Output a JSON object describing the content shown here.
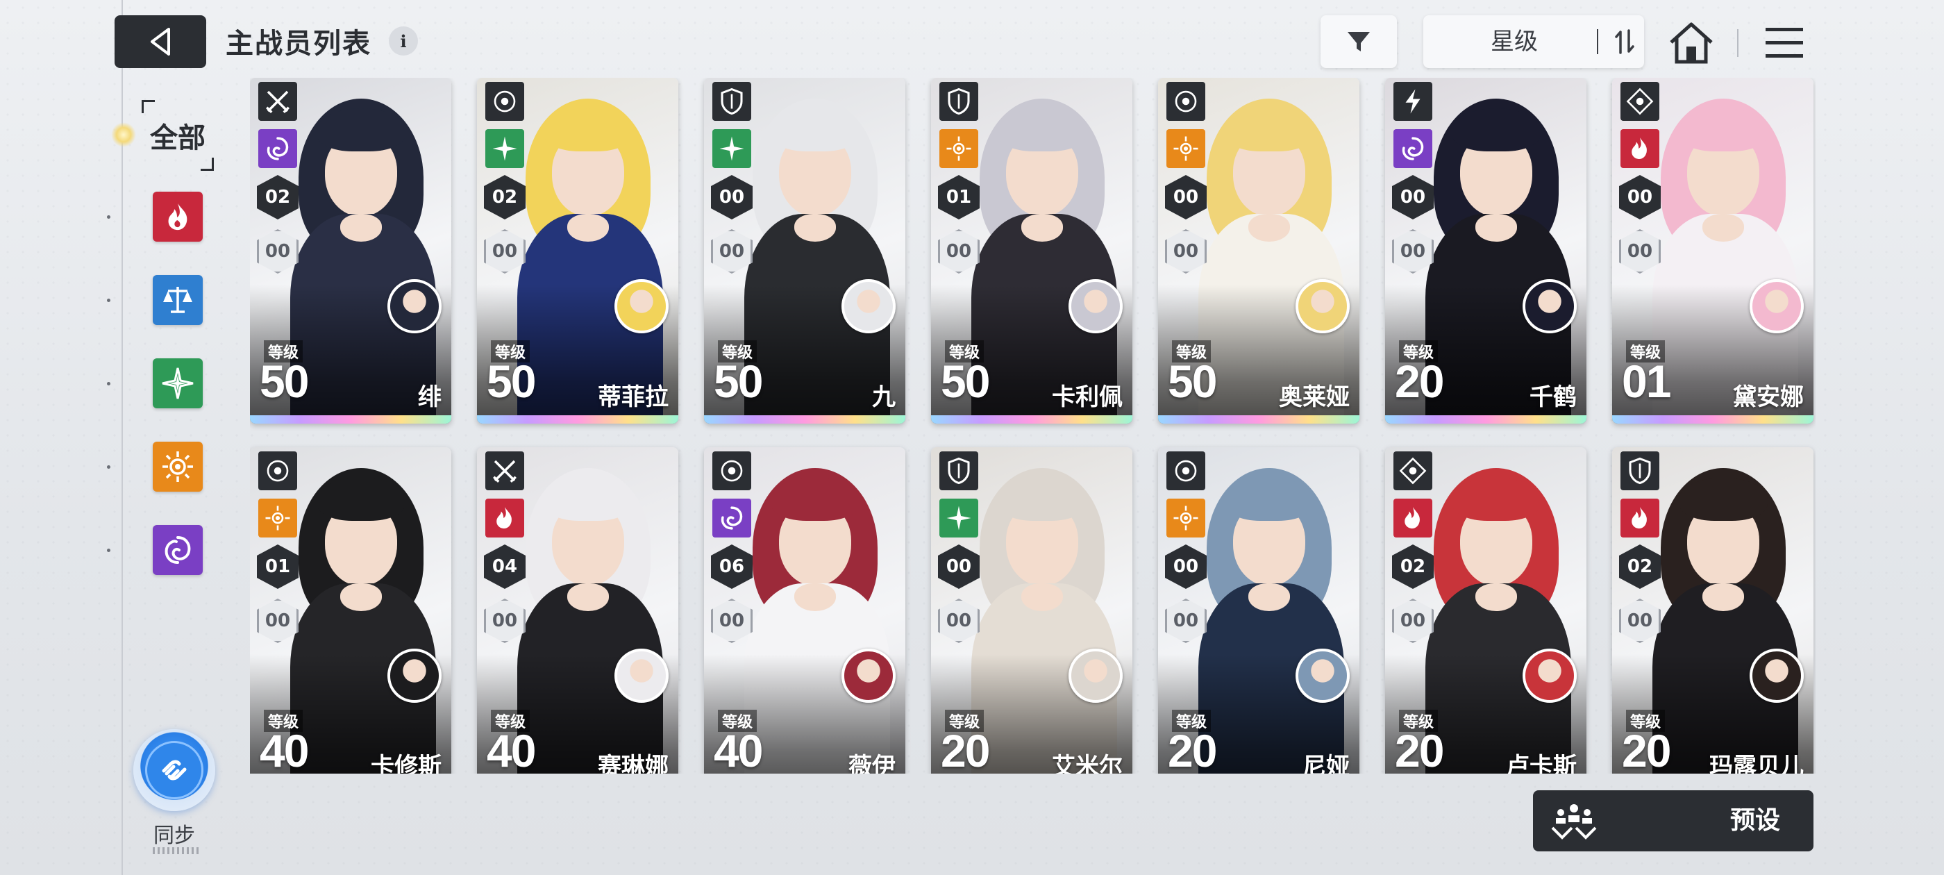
{
  "header": {
    "title": "主战员列表",
    "info_icon": "i",
    "sort_label": "星级"
  },
  "sidebar": {
    "all_label": "全部",
    "filters": [
      {
        "name": "fire",
        "color": "#c8283c"
      },
      {
        "name": "balance",
        "color": "#2f7fd0"
      },
      {
        "name": "wind",
        "color": "#2e9a57"
      },
      {
        "name": "light",
        "color": "#e8891a"
      },
      {
        "name": "void",
        "color": "#7a3fc4"
      }
    ],
    "sync_label": "同步"
  },
  "cards": [
    {
      "name": "绯",
      "level": "50",
      "level_label": "等级",
      "rank": "02",
      "stars": "00",
      "role_icon": "crossed-swords-icon",
      "element": "void",
      "elem_color": "#7a3fc4",
      "hair": "#23283a",
      "outfit": "#2a2f45",
      "bg": "#d8d9de"
    },
    {
      "name": "蒂菲拉",
      "level": "50",
      "level_label": "等级",
      "rank": "02",
      "stars": "00",
      "role_icon": "target-icon",
      "element": "wind",
      "elem_color": "#2e9a57",
      "hair": "#f2d35a",
      "outfit": "#24357a",
      "bg": "#e4e2dc"
    },
    {
      "name": "九",
      "level": "50",
      "level_label": "等级",
      "rank": "00",
      "stars": "00",
      "role_icon": "shield-icon",
      "element": "wind",
      "elem_color": "#2e9a57",
      "hair": "#e6e7ea",
      "outfit": "#2a2c30",
      "bg": "#dfe0e3"
    },
    {
      "name": "卡利佩",
      "level": "50",
      "level_label": "等级",
      "rank": "01",
      "stars": "00",
      "role_icon": "shield-icon",
      "element": "light",
      "elem_color": "#e8891a",
      "hair": "#c9c8d2",
      "outfit": "#2e2c34",
      "bg": "#e0dfe2"
    },
    {
      "name": "奥莱娅",
      "level": "50",
      "level_label": "等级",
      "rank": "00",
      "stars": "00",
      "role_icon": "target-icon",
      "element": "light",
      "elem_color": "#e8891a",
      "hair": "#f0d478",
      "outfit": "#f4f1ea",
      "bg": "#e6e3dc"
    },
    {
      "name": "千鹤",
      "level": "20",
      "level_label": "等级",
      "rank": "00",
      "stars": "00",
      "role_icon": "lightning-icon",
      "element": "void",
      "elem_color": "#7a3fc4",
      "hair": "#1b1c2e",
      "outfit": "#1a1a22",
      "bg": "#dcd9de"
    },
    {
      "name": "黛安娜",
      "level": "01",
      "level_label": "等级",
      "rank": "00",
      "stars": "00",
      "role_icon": "diamond-target-icon",
      "element": "fire",
      "elem_color": "#c8283c",
      "hair": "#f3b9cf",
      "outfit": "#f4f0f4",
      "bg": "#e9e4ea"
    },
    {
      "name": "卡修斯",
      "level": "40",
      "level_label": "等级",
      "rank": "01",
      "stars": "00",
      "role_icon": "target-icon",
      "element": "light",
      "elem_color": "#e8891a",
      "hair": "#1c1c1e",
      "outfit": "#252528",
      "bg": "#dedfe2"
    },
    {
      "name": "赛琳娜",
      "level": "40",
      "level_label": "等级",
      "rank": "04",
      "stars": "00",
      "role_icon": "crossed-swords-icon",
      "element": "fire",
      "elem_color": "#c8283c",
      "hair": "#ecebee",
      "outfit": "#222226",
      "bg": "#e2e1e4"
    },
    {
      "name": "薇伊",
      "level": "40",
      "level_label": "等级",
      "rank": "06",
      "stars": "00",
      "role_icon": "target-icon",
      "element": "void",
      "elem_color": "#7a3fc4",
      "hair": "#9c2a3a",
      "outfit": "#f4f4f6",
      "bg": "#e3e2e6"
    },
    {
      "name": "艾米尔",
      "level": "20",
      "level_label": "等级",
      "rank": "00",
      "stars": "00",
      "role_icon": "shield-icon",
      "element": "wind",
      "elem_color": "#2e9a57",
      "hair": "#dcd6cf",
      "outfit": "#e4ddd4",
      "bg": "#e0ddd9"
    },
    {
      "name": "尼娅",
      "level": "20",
      "level_label": "等级",
      "rank": "00",
      "stars": "00",
      "role_icon": "target-icon",
      "element": "light",
      "elem_color": "#e8891a",
      "hair": "#7e98b4",
      "outfit": "#22304a",
      "bg": "#dde0e5"
    },
    {
      "name": "卢卡斯",
      "level": "20",
      "level_label": "等级",
      "rank": "02",
      "stars": "00",
      "role_icon": "diamond-target-icon",
      "element": "fire",
      "elem_color": "#c8283c",
      "hair": "#c8343a",
      "outfit": "#2a2a2e",
      "bg": "#dedfe2"
    },
    {
      "name": "玛露贝儿",
      "level": "20",
      "level_label": "等级",
      "rank": "02",
      "stars": "00",
      "role_icon": "shield-icon",
      "element": "fire",
      "elem_color": "#c8283c",
      "hair": "#2a211f",
      "outfit": "#1f1e22",
      "bg": "#e2e0de"
    }
  ],
  "preset": {
    "label": "预设"
  }
}
